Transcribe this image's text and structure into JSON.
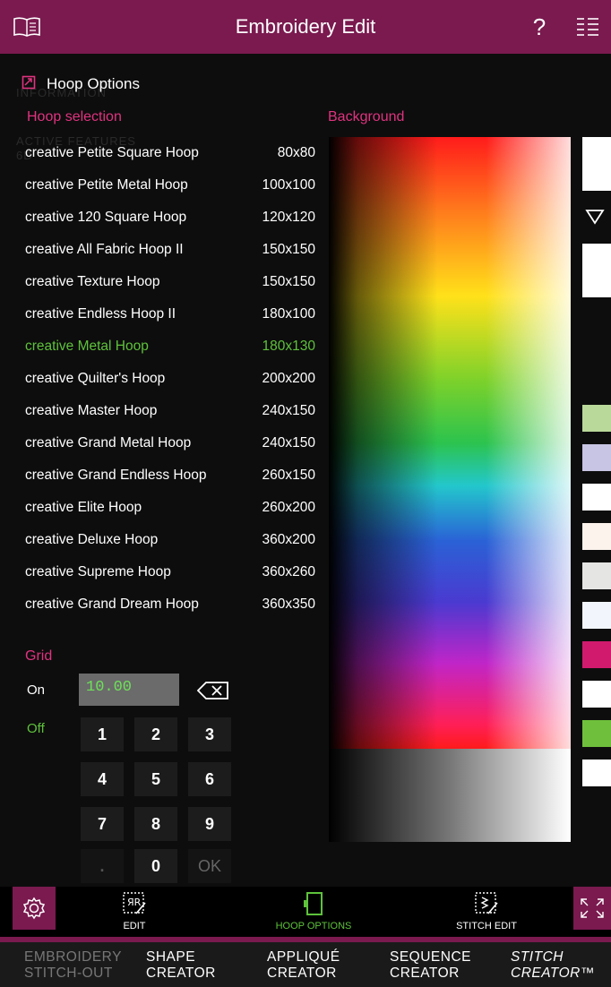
{
  "app": {
    "title": "Embroidery Edit",
    "help_label": "?"
  },
  "panel": {
    "title": "Hoop Options",
    "ghost_text": [
      "INFORMATION",
      "ACTIVE FEATURES",
      "6D"
    ],
    "hoop_section_title": "Hoop selection",
    "background_section_title": "Background",
    "hoops": [
      {
        "name": "creative Petite Square Hoop",
        "size": "80x80"
      },
      {
        "name": "creative Petite Metal Hoop",
        "size": "100x100"
      },
      {
        "name": "creative 120 Square Hoop",
        "size": "120x120"
      },
      {
        "name": "creative All Fabric Hoop II",
        "size": "150x150"
      },
      {
        "name": "creative Texture Hoop",
        "size": "150x150"
      },
      {
        "name": "creative Endless Hoop II",
        "size": "180x100"
      },
      {
        "name": "creative Metal Hoop",
        "size": "180x130",
        "selected": true
      },
      {
        "name": "creative Quilter's Hoop",
        "size": "200x200"
      },
      {
        "name": "creative Master Hoop",
        "size": "240x150"
      },
      {
        "name": "creative Grand Metal Hoop",
        "size": "240x150"
      },
      {
        "name": "creative Grand Endless Hoop",
        "size": "260x150"
      },
      {
        "name": "creative Elite Hoop",
        "size": "260x200"
      },
      {
        "name": "creative Deluxe Hoop",
        "size": "360x200"
      },
      {
        "name": "creative Supreme Hoop",
        "size": "360x260"
      },
      {
        "name": "creative Grand Dream Hoop",
        "size": "360x350"
      }
    ],
    "swatches": [
      "#ffffff",
      "#ffffff",
      "#b9d99a",
      "#c8c4e3",
      "#ffffff",
      "#fbf3ec",
      "#e5e5e3",
      "#f2f5fb",
      "#d11a6e",
      "#ffffff",
      "#6fbf3c",
      "#ffffff"
    ],
    "grid": {
      "title": "Grid",
      "on_label": "On",
      "off_label": "Off",
      "value": "10.00",
      "keys": [
        "1",
        "2",
        "3",
        "4",
        "5",
        "6",
        "7",
        "8",
        "9",
        ".",
        "0",
        "OK"
      ]
    }
  },
  "toolbar": {
    "edit_label": "EDIT",
    "hoop_options_label": "HOOP OPTIONS",
    "stitch_edit_label": "STITCH EDIT"
  },
  "bottom_nav": [
    {
      "line1": "EMBROIDERY",
      "line2": "STITCH-OUT"
    },
    {
      "line1": "SHAPE",
      "line2": "CREATOR"
    },
    {
      "line1": "APPLIQUÉ",
      "line2": "CREATOR"
    },
    {
      "line1": "SEQUENCE",
      "line2": "CREATOR"
    },
    {
      "line1": "STITCH",
      "line2": "CREATOR™"
    }
  ],
  "colors": {
    "brand": "#7a1a4f",
    "accent_pink": "#e0337f",
    "selected_green": "#5ec23b"
  },
  "icons": [
    "book-icon",
    "help-icon",
    "menu-icon",
    "hoop-options-icon",
    "triangle-down-icon",
    "backspace-icon",
    "settings-gear-icon",
    "edit-icon",
    "hoop-icon",
    "stitch-edit-icon",
    "collapse-icon"
  ]
}
